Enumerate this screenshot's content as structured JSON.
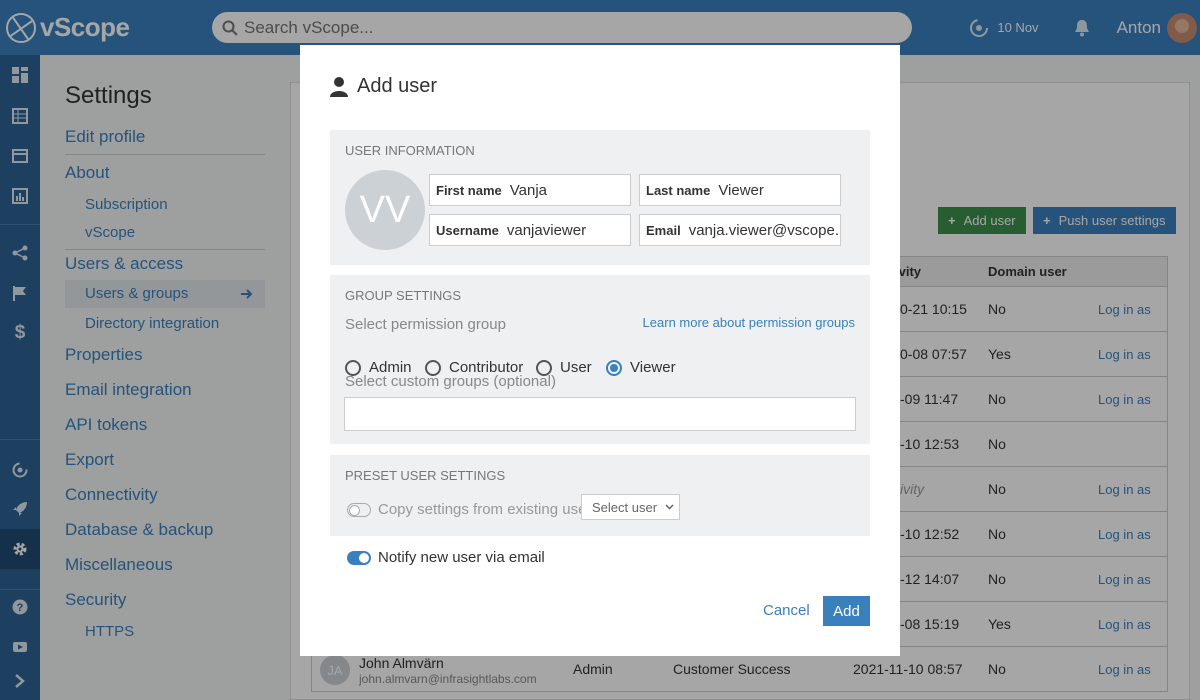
{
  "app": {
    "name": "vScope"
  },
  "search": {
    "placeholder": "Search vScope..."
  },
  "topbar": {
    "date": "10 Nov",
    "user": "Anton"
  },
  "settings": {
    "title": "Settings",
    "items": [
      {
        "label": "Edit profile"
      },
      {
        "label": "About"
      },
      {
        "label": "Subscription"
      },
      {
        "label": "vScope"
      },
      {
        "label": "Users & access"
      },
      {
        "label": "Users & groups"
      },
      {
        "label": "Directory integration"
      },
      {
        "label": "Properties"
      },
      {
        "label": "Email integration"
      },
      {
        "label": "API tokens"
      },
      {
        "label": "Export"
      },
      {
        "label": "Connectivity"
      },
      {
        "label": "Database & backup"
      },
      {
        "label": "Miscellaneous"
      },
      {
        "label": "Security"
      },
      {
        "label": "HTTPS"
      }
    ]
  },
  "toolbar": {
    "add_user": "Add user",
    "push_settings": "Push user settings"
  },
  "table": {
    "headers": [
      "ivity",
      "Domain user"
    ],
    "rows": [
      {
        "activity": "0-21 10:15",
        "domain": "No",
        "action": "Log in as"
      },
      {
        "activity": "0-08 07:57",
        "domain": "Yes",
        "action": "Log in as"
      },
      {
        "activity": "-09 11:47",
        "domain": "No",
        "action": "Log in as"
      },
      {
        "activity": "-10 12:53",
        "domain": "No",
        "action": ""
      },
      {
        "activity": "ivity",
        "domain": "No",
        "action": "Log in as"
      },
      {
        "activity": "-10 12:52",
        "domain": "No",
        "action": "Log in as"
      },
      {
        "activity": "-12 14:07",
        "domain": "No",
        "action": "Log in as"
      },
      {
        "activity": "-08 15:19",
        "domain": "Yes",
        "action": "Log in as"
      }
    ],
    "last_row": {
      "initials": "JA",
      "name": "John Almvärn",
      "email": "john.almvarn@infrasightlabs.com",
      "role": "Admin",
      "group": "Customer Success",
      "activity": "2021-11-10 08:57",
      "domain": "No",
      "action": "Log in as"
    }
  },
  "modal": {
    "title": "Add user",
    "user_info": {
      "heading": "USER INFORMATION",
      "initials": "VV",
      "first_name_label": "First name",
      "first_name": "Vanja",
      "last_name_label": "Last name",
      "last_name": "Viewer",
      "username_label": "Username",
      "username": "vanjaviewer",
      "email_label": "Email",
      "email": "vanja.viewer@vscope.n"
    },
    "group": {
      "heading": "GROUP SETTINGS",
      "permission_label": "Select permission group",
      "learn_more": "Learn more about permission groups",
      "options": [
        "Admin",
        "Contributor",
        "User",
        "Viewer"
      ],
      "selected": "Viewer",
      "custom_label": "Select custom groups (optional)",
      "custom_value": ""
    },
    "preset": {
      "heading": "PRESET USER SETTINGS",
      "copy_label": "Copy settings from existing user",
      "select_placeholder": "Select user"
    },
    "notify_label": "Notify new user via email",
    "cancel": "Cancel",
    "add": "Add"
  },
  "colors": {
    "brand": "#3a80bd",
    "sidebar": "#2d6394",
    "green": "#3b8f4c"
  }
}
